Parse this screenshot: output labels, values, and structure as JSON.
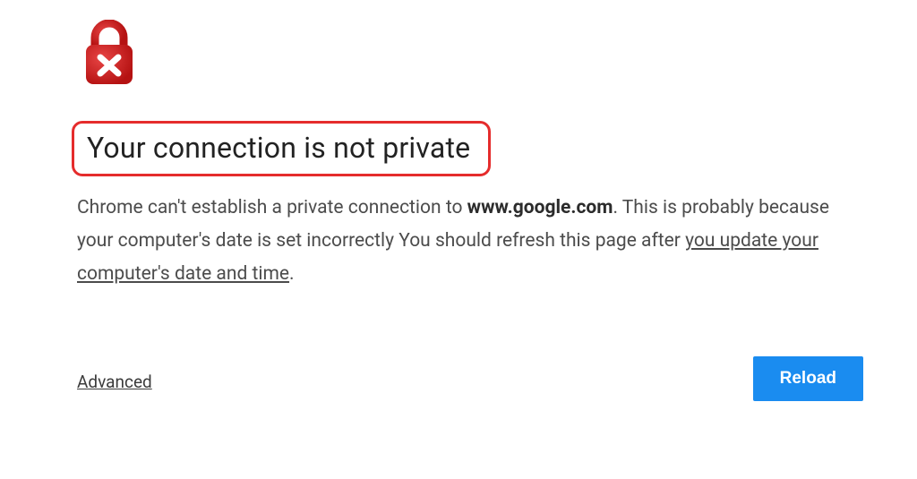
{
  "icon": {
    "name": "broken-lock",
    "lock_color": "#c21818",
    "lock_gradient_light": "#e33b3b",
    "x_color": "#ffffff"
  },
  "heading": "Your connection is not private",
  "body": {
    "prefix": "Chrome can't establish a private connection to ",
    "host": "www.google.com",
    "mid": ". This is probably because your computer's date is set incorrectly You should refresh this page after ",
    "link_text": "you update your computer's date and time",
    "suffix": "."
  },
  "advanced_label": "Advanced",
  "reload_label": "Reload",
  "highlight_color": "#e52c2c",
  "button_color": "#1a8cf0"
}
